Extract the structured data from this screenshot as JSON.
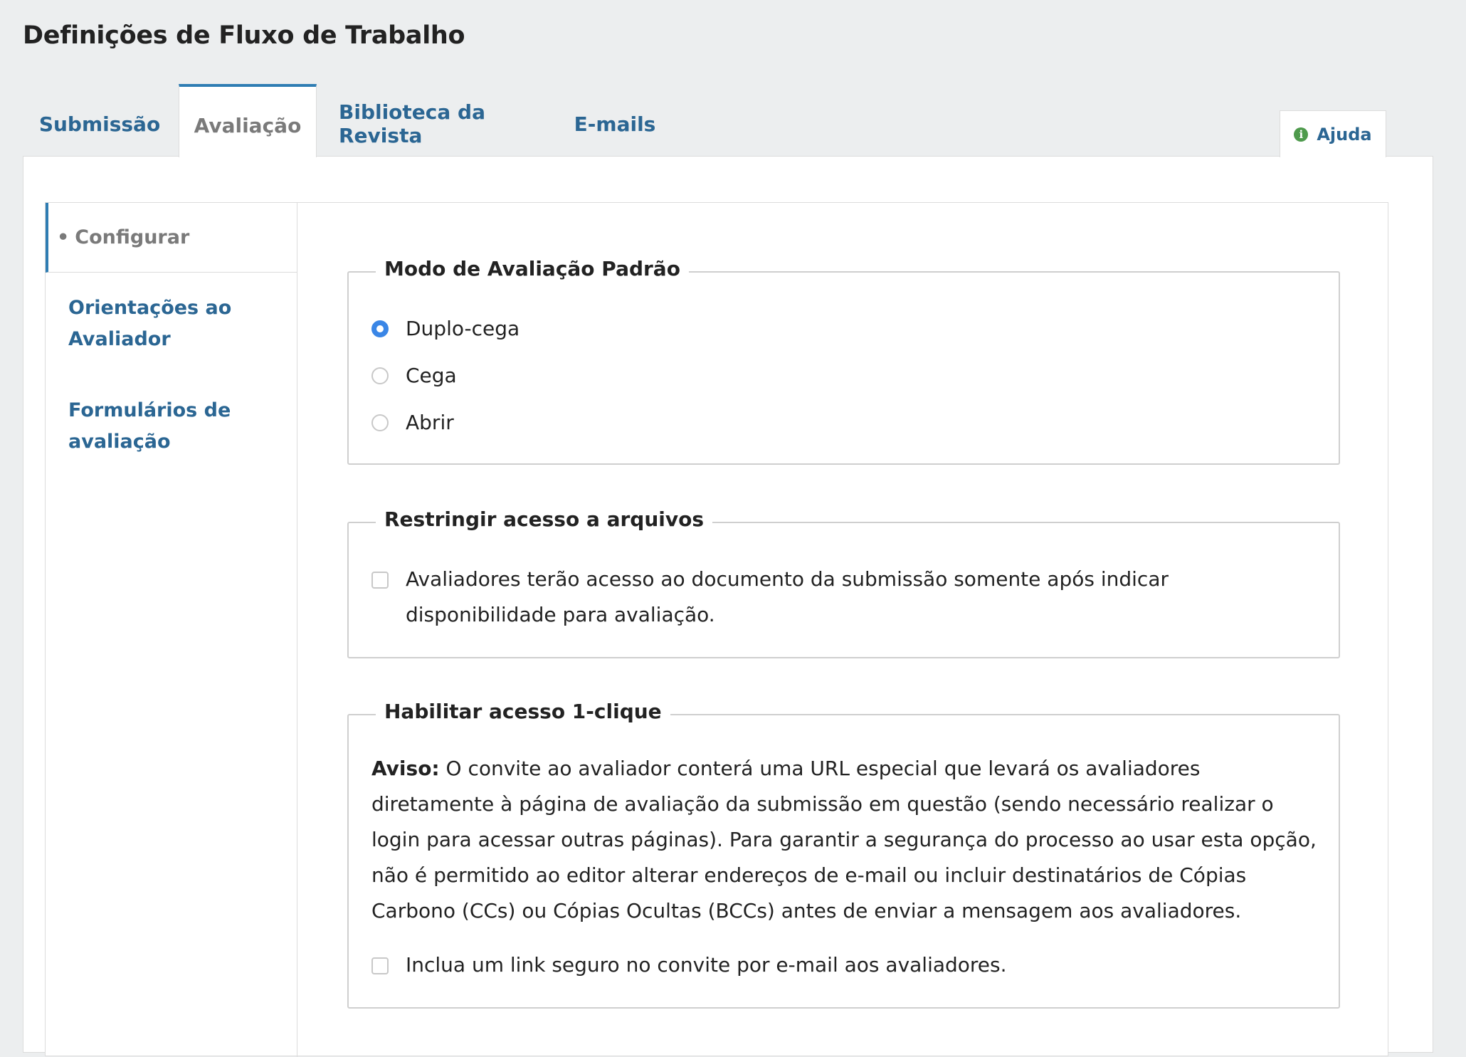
{
  "page": {
    "title": "Definições de Fluxo de Trabalho"
  },
  "tabs": [
    {
      "label": "Submissão"
    },
    {
      "label": "Avaliação",
      "active": true
    },
    {
      "label": "Biblioteca da Revista"
    },
    {
      "label": "E-mails"
    }
  ],
  "help": {
    "label": "Ajuda",
    "icon": "info-icon"
  },
  "sidenav": {
    "items": [
      {
        "label": "Configurar",
        "active": true
      },
      {
        "label": "Orientações ao Avaliador"
      },
      {
        "label": "Formulários de avaliação"
      }
    ]
  },
  "review_mode": {
    "legend": "Modo de Avaliação Padrão",
    "options": [
      {
        "label": "Duplo-cega",
        "checked": true
      },
      {
        "label": "Cega",
        "checked": false
      },
      {
        "label": "Abrir",
        "checked": false
      }
    ]
  },
  "restrict_access": {
    "legend": "Restringir acesso a arquivos",
    "checkbox_label": "Avaliadores terão acesso ao documento da submissão somente após indicar disponibilidade para avaliação.",
    "checked": false
  },
  "one_click": {
    "legend": "Habilitar acesso 1-clique",
    "notice_label": "Aviso:",
    "notice_text": " O convite ao avaliador conterá uma URL especial que levará os avaliadores diretamente à página de avaliação da submissão em questão (sendo necessário realizar o login para acessar outras páginas). Para garantir a segurança do processo ao usar esta opção, não é permitido ao editor alterar endereços de e-mail ou incluir destinatários de Cópias Carbono (CCs) ou Cópias Ocultas (BCCs) antes de enviar a mensagem aos avaliadores.",
    "checkbox_label": "Inclua um link seguro no convite por e-mail aos avaliadores.",
    "checked": false
  },
  "colors": {
    "link": "#2b6693",
    "accent": "#2f7db3",
    "radio_checked": "#3a86e6",
    "help_icon": "#4e9a4c"
  }
}
